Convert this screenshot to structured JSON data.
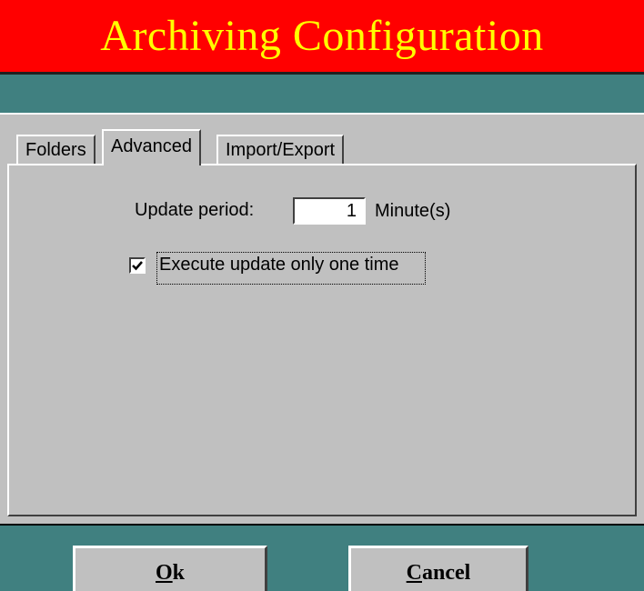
{
  "banner": {
    "title": "Archiving Configuration",
    "color_bg": "#ff0000",
    "color_text": "#ffff00"
  },
  "tabs": [
    {
      "label": "Folders",
      "active": false
    },
    {
      "label": "Advanced",
      "active": true
    },
    {
      "label": "Import/Export",
      "active": false
    }
  ],
  "advanced": {
    "update_period_label": "Update period:",
    "update_period_value": "1",
    "update_period_unit": "Minute(s)",
    "execute_once_label": "Execute update only one time",
    "execute_once_checked": true
  },
  "buttons": {
    "ok": {
      "accel": "O",
      "rest": "k"
    },
    "cancel": {
      "accel": "C",
      "rest": "ancel"
    }
  },
  "colors": {
    "background": "#408080",
    "panel": "#c0c0c0"
  }
}
